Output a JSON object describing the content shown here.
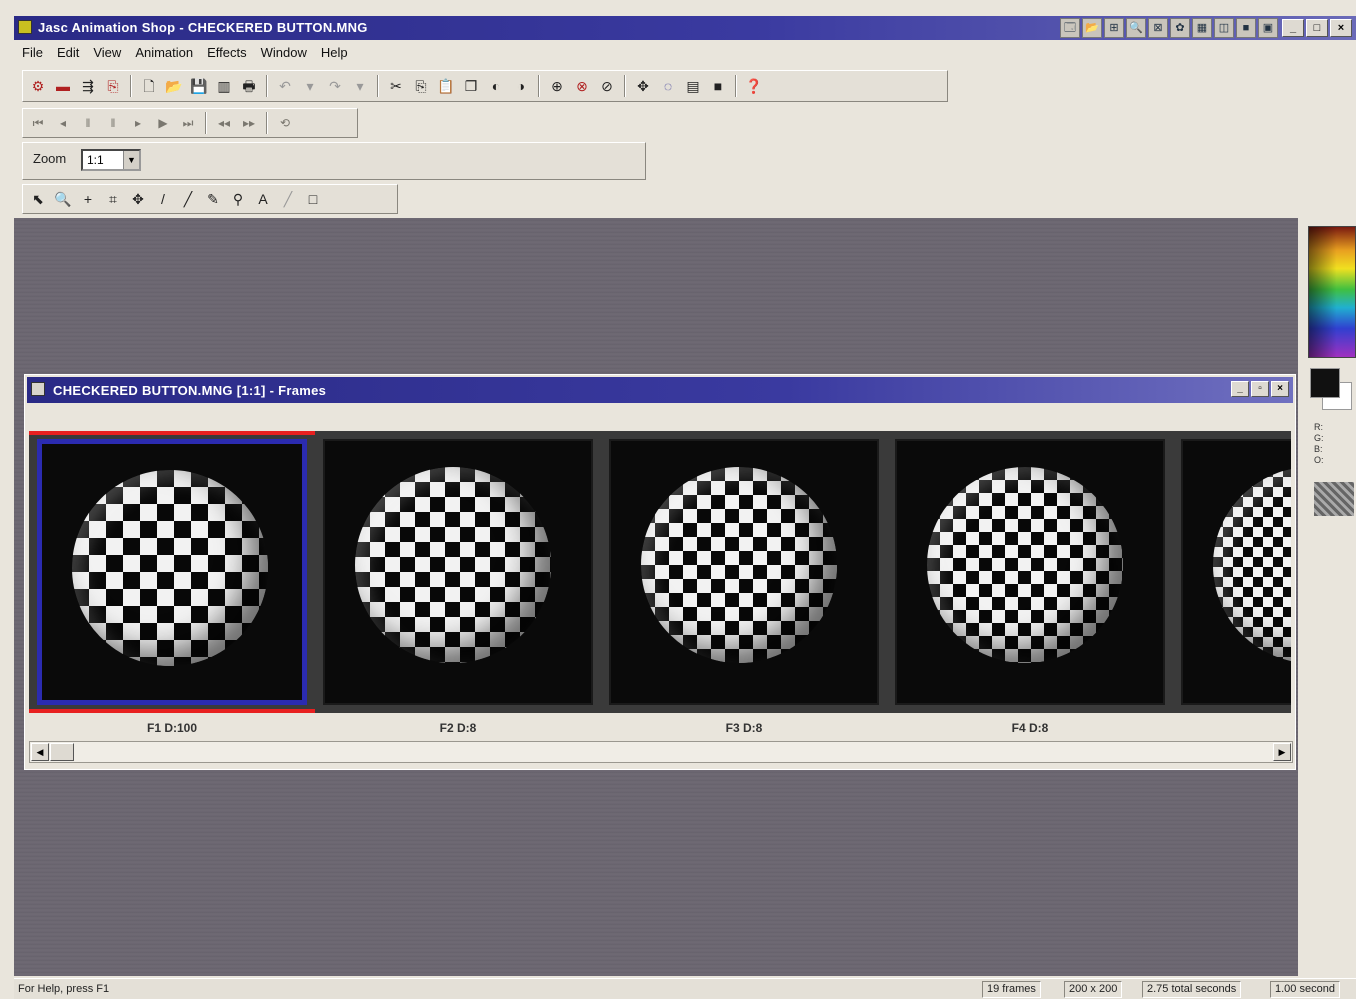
{
  "window": {
    "title": "Jasc Animation Shop - CHECKERED BUTTON.MNG",
    "toolbar_icons": [
      "🗔",
      "📂",
      "⊞",
      "🔍",
      "⊠",
      "✿",
      "▦",
      "◫",
      "■",
      "▣"
    ],
    "buttons": {
      "minimize": "_",
      "maximize": "□",
      "close": "×"
    }
  },
  "menu": [
    "File",
    "Edit",
    "View",
    "Animation",
    "Effects",
    "Window",
    "Help"
  ],
  "toolbar_main": {
    "icons": [
      "wizard-icon",
      "banner-icon",
      "optimize-icon",
      "transition-icon",
      "new-icon",
      "open-icon",
      "save-icon",
      "save-all-icon",
      "print-icon",
      "undo-icon",
      "undo-dropdown-icon",
      "redo-icon",
      "redo-dropdown-icon",
      "cut-icon",
      "copy-icon",
      "paste-icon",
      "paste-frame-icon",
      "paste-before-icon",
      "paste-after-icon",
      "insert-frame-icon",
      "delete-frame-icon",
      "crop-icon",
      "view-icon",
      "preview-icon",
      "frame-size-icon",
      "black-fill-icon",
      "help-icon"
    ],
    "glyphs": [
      "⚙",
      "▬",
      "⇶",
      "⎘",
      "🗋",
      "📂",
      "💾",
      "▥",
      "🖶",
      "↶",
      "▾",
      "↷",
      "▾",
      "✂",
      "⎘",
      "📋",
      "❐",
      "◐",
      "◑",
      "⊕",
      "⊗",
      "⊘",
      "✥",
      "◌",
      "▤",
      "■",
      "❓"
    ]
  },
  "toolbar_playback": {
    "glyphs": [
      "⏮",
      "◂",
      "‖",
      "‖",
      "▸",
      "▶",
      "⏭",
      "◂◂",
      "▸▸",
      "⟲"
    ]
  },
  "zoom": {
    "label": "Zoom",
    "value": "1:1"
  },
  "toolbar_tools": {
    "icons": [
      "arrow-tool-icon",
      "zoom-tool-icon",
      "crosshair-tool-icon",
      "crop-tool-icon",
      "mover-tool-icon",
      "paintbrush-tool-icon",
      "eraser-tool-icon",
      "dropper-tool-icon",
      "fill-tool-icon",
      "text-tool-icon",
      "line-tool-icon",
      "rectangle-tool-icon"
    ],
    "glyphs": [
      "⬉",
      "🔍",
      "+",
      "⌗",
      "✥",
      "/",
      "╱",
      "✎",
      "⚲",
      "A",
      "╱",
      "□"
    ]
  },
  "frames_window": {
    "title": "CHECKERED BUTTON.MNG [1:1] - Frames",
    "frames": [
      {
        "label": "F1  D:100",
        "selected": true
      },
      {
        "label": "F2  D:8",
        "selected": false
      },
      {
        "label": "F3  D:8",
        "selected": false
      },
      {
        "label": "F4  D:8",
        "selected": false
      },
      {
        "label": "",
        "selected": false
      }
    ]
  },
  "palette": {
    "small_labels": [
      "R:",
      "G:",
      "B:",
      "O:"
    ]
  },
  "status": {
    "help": "For Help, press F1",
    "frames": "19 frames",
    "size": "200 x 200",
    "total_seconds": "2.75 total seconds",
    "current": "1.00 second"
  }
}
